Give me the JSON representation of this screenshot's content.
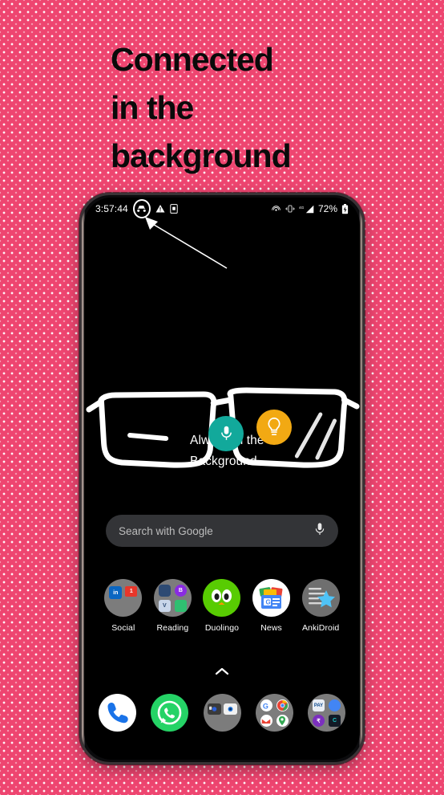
{
  "headline": {
    "line1": "Connected",
    "line2": "in the",
    "line3": "background"
  },
  "colors": {
    "background_pink": "#ee4570",
    "dot_pattern": "#ffffff",
    "headline_text": "#0a0a0a",
    "screen_black": "#000000",
    "folder_gray": "#7c7c7c",
    "search_pill": "#333437",
    "mic_teal": "#12A99B",
    "bulb_orange": "#F2A913",
    "whatsapp_green": "#25D366",
    "duolingo_green": "#58CC02",
    "linkedin_blue": "#0A66C2",
    "badge_red": "#E8362A"
  },
  "phone": {
    "statusbar": {
      "time": "3:57:44",
      "left_icons": [
        {
          "name": "incognito-icon",
          "circled": true
        },
        {
          "name": "warning-triangle-icon"
        },
        {
          "name": "sim-card-icon"
        }
      ],
      "right_icons": [
        {
          "name": "cast-icon"
        },
        {
          "name": "vibrate-icon"
        },
        {
          "name": "signal-4g-icon",
          "label": "4G"
        }
      ],
      "battery_percent": "72%",
      "battery_icon": "battery-charging-icon"
    },
    "annotation": {
      "line1": "Always in the",
      "line2": "Background",
      "arrow": "arrow-pointing-to-incognito-icon"
    },
    "wallpaper": {
      "description": "hand-drawn-glasses",
      "overlay_icons": [
        {
          "name": "google-assistant-mic-icon",
          "color": "#12A99B"
        },
        {
          "name": "google-keep-bulb-icon",
          "color": "#F2A913"
        }
      ]
    },
    "search": {
      "placeholder": "Search with Google",
      "voice_icon": "microphone-icon"
    },
    "apps": [
      {
        "label": "Social",
        "icon": "folder-social-icon",
        "type": "folder",
        "badge": "1"
      },
      {
        "label": "Reading",
        "icon": "folder-reading-icon",
        "type": "folder"
      },
      {
        "label": "Duolingo",
        "icon": "duolingo-icon",
        "type": "app"
      },
      {
        "label": "News",
        "icon": "google-news-icon",
        "type": "app"
      },
      {
        "label": "AnkiDroid",
        "icon": "ankidroid-icon",
        "type": "app"
      }
    ],
    "app_drawer_indicator": "chevron-up-icon",
    "dock": [
      {
        "label": "Phone",
        "icon": "phone-dialer-icon",
        "type": "app"
      },
      {
        "label": "WhatsApp",
        "icon": "whatsapp-icon",
        "type": "app"
      },
      {
        "label": "Camera",
        "icon": "folder-camera-icon",
        "type": "folder"
      },
      {
        "label": "Google",
        "icon": "folder-google-icon",
        "type": "folder"
      },
      {
        "label": "Payments",
        "icon": "folder-payments-icon",
        "type": "folder"
      }
    ]
  }
}
